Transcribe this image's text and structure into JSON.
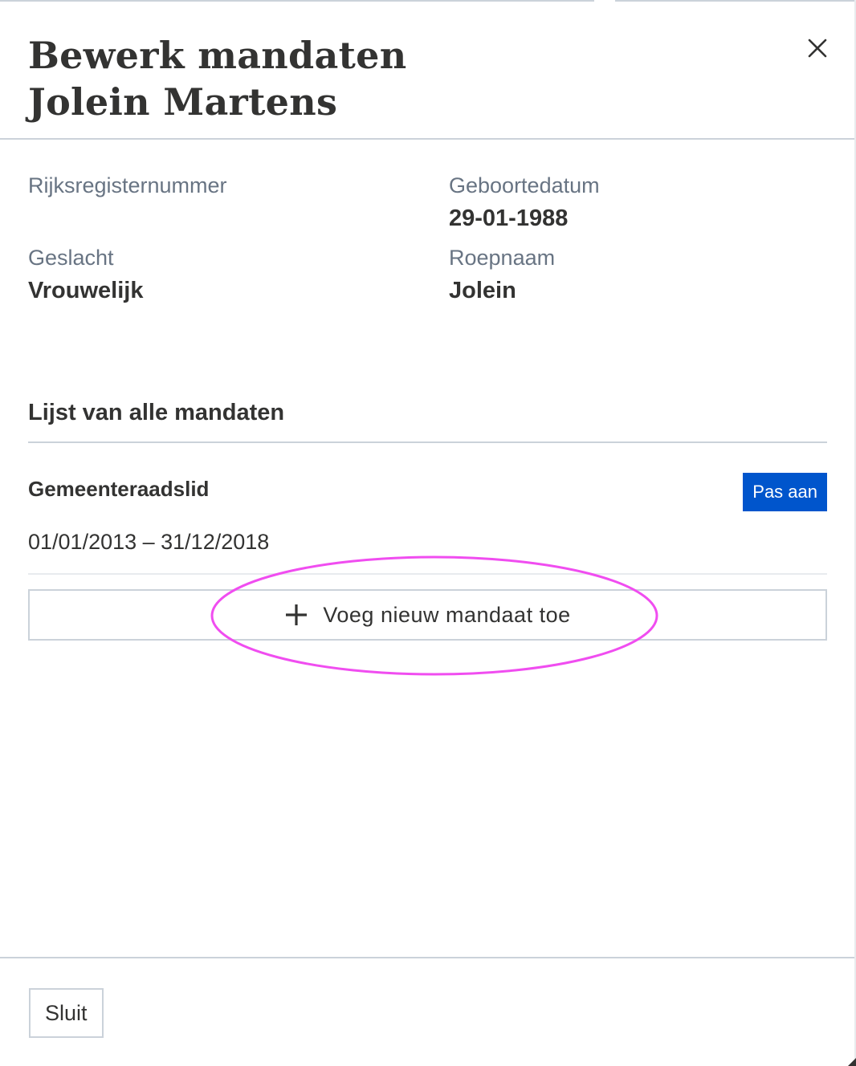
{
  "header": {
    "title_line1": "Bewerk mandaten",
    "title_line2": "Jolein Martens",
    "close_icon": "close-icon"
  },
  "person": {
    "rrn_label": "Rijksregisternummer",
    "rrn_value": "",
    "birthdate_label": "Geboortedatum",
    "birthdate_value": "29-01-1988",
    "gender_label": "Geslacht",
    "gender_value": "Vrouwelijk",
    "nickname_label": "Roepnaam",
    "nickname_value": "Jolein"
  },
  "mandates": {
    "section_title": "Lijst van alle mandaten",
    "items": [
      {
        "name": "Gemeenteraadslid",
        "period": "01/01/2013 – 31/12/2018",
        "edit_label": "Pas aan"
      }
    ],
    "add_label": "Voeg nieuw mandaat toe",
    "add_icon": "plus-icon"
  },
  "footer": {
    "close_label": "Sluit"
  },
  "colors": {
    "primary": "#0055cc",
    "highlight": "#f04df0",
    "text": "#333332",
    "muted": "#687483",
    "border": "#cbd2da"
  }
}
